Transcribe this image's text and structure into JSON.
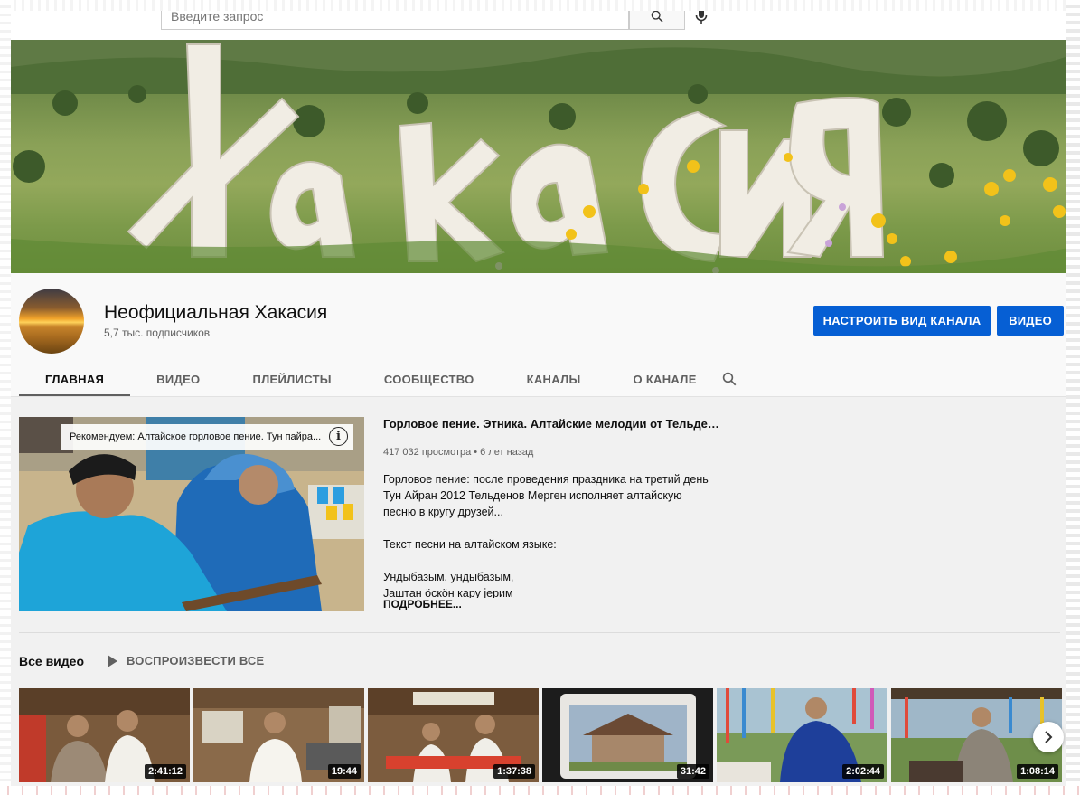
{
  "search": {
    "placeholder": "Введите запрос"
  },
  "banner": {
    "text": "Хакасия"
  },
  "channel": {
    "name": "Неофициальная Хакасия",
    "subscribers": "5,7 тыс. подписчиков",
    "customize_button": "НАСТРОИТЬ ВИД КАНАЛА",
    "videos_button": "ВИДЕО"
  },
  "tabs": [
    "ГЛАВНАЯ",
    "ВИДЕО",
    "ПЛЕЙЛИСТЫ",
    "СООБЩЕСТВО",
    "КАНАЛЫ",
    "О КАНАЛЕ"
  ],
  "featured": {
    "overlay": "Рекомендуем: Алтайское горловое пение. Тун пайра...",
    "info_glyph": "i",
    "title": "Горловое пение. Этника. Алтайские мелодии от Тельден...",
    "meta": "417 032 просмотра • 6 лет назад",
    "description": "Горловое пение: после проведения праздника на третий день Тун Айран 2012 Тельденов Мерген исполняет алтайскую песню в кругу друзей...\n\nТекст песни на алтайском языке:\n\nУндыбазым, ундыбазым,\nЈаштан ӧскӧн кару јерим",
    "more": "ПОДРОБНЕЕ..."
  },
  "shelf": {
    "title": "Все видео",
    "play_all": "ВОСПРОИЗВЕСТИ ВСЕ",
    "videos": [
      {
        "duration": "2:41:12"
      },
      {
        "duration": "19:44"
      },
      {
        "duration": "1:37:38"
      },
      {
        "duration": "31:42"
      },
      {
        "duration": "2:02:44"
      },
      {
        "duration": "1:08:14"
      }
    ]
  },
  "colors": {
    "accent": "#065fd4",
    "background": "#f9f9f9",
    "shelf_bg": "#f1f1f1"
  },
  "icons": [
    "search-icon",
    "mic-icon",
    "info-icon",
    "play-icon",
    "chevron-right-icon"
  ]
}
